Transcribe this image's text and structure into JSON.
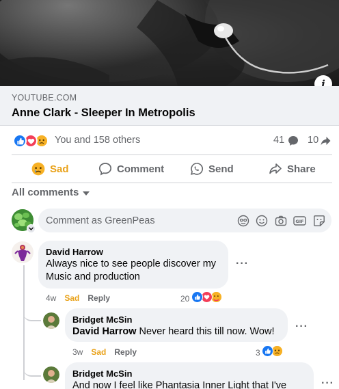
{
  "link": {
    "domain": "YOUTUBE.COM",
    "title": "Anne Clark - Sleeper In Metropolis"
  },
  "reactions_summary": {
    "text": "You and 158 others",
    "comments_count": "41",
    "shares_count": "10",
    "types": [
      "like",
      "love",
      "sad"
    ]
  },
  "actions": {
    "sad": "Sad",
    "comment": "Comment",
    "send": "Send",
    "share": "Share"
  },
  "filter": {
    "label": "All comments"
  },
  "composer": {
    "placeholder": "Comment as GreenPeas",
    "tools": [
      "avatar-sticker-icon",
      "emoji-icon",
      "camera-icon",
      "gif-icon",
      "sticker-icon"
    ]
  },
  "comments": [
    {
      "author": "David Harrow",
      "text": "Always nice to see people discover my Music and production",
      "time": "4w",
      "reaction_label": "Sad",
      "reply_label": "Reply",
      "reaction_count": "20",
      "reactions": [
        "like",
        "love",
        "care"
      ],
      "more": "···"
    },
    {
      "author": "Bridget McSin",
      "mention": "David Harrow",
      "text": "Never heard this till now. Wow!",
      "time": "3w",
      "reaction_label": "Sad",
      "reply_label": "Reply",
      "reaction_count": "3",
      "reactions": [
        "like",
        "sad"
      ],
      "more": "···"
    },
    {
      "author": "Bridget McSin",
      "text": "And now I feel like Phantasia Inner Light that I've",
      "more": "···"
    }
  ],
  "colors": {
    "facebook_blue": "#1877f2",
    "love_red": "#f33e58",
    "sad_yellow": "#f7b125",
    "secondary_text": "#65676b",
    "bubble_bg": "#f0f2f5"
  }
}
